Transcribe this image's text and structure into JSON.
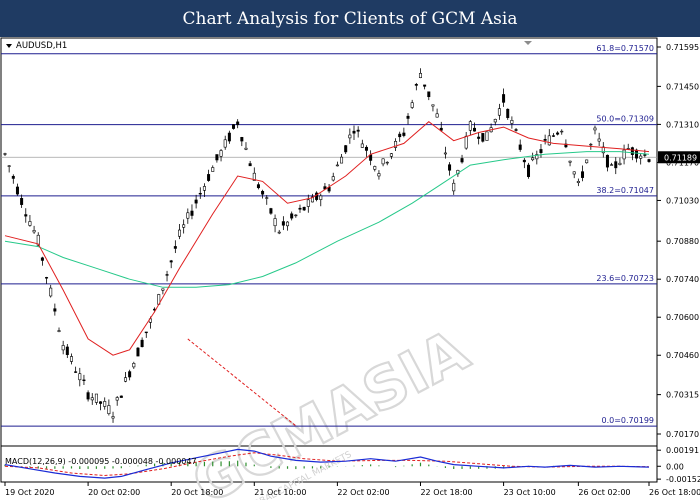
{
  "header": {
    "title": "Chart Analysis for Clients of GCM Asia"
  },
  "chart_data": {
    "type": "candlestick",
    "symbol": "AUDUSD,H1",
    "watermark": "GCMASIA",
    "watermark_sub": "GLOBAL CAPITAL MARKETS",
    "colors": {
      "background": "#ffffff",
      "bull_candle": "#ffffff",
      "bear_candle": "#000000",
      "fib_lines": "#1d1d8f",
      "ma_fast": "#e02020",
      "ma_slow": "#27c98a",
      "macd_line": "#1a2bd6",
      "signal_line": "#e02020",
      "histogram": "#2f8f2f",
      "price_label_bg": "#000000"
    },
    "y_ticks": [
      "0.71595",
      "0.71450",
      "0.71310",
      "0.71170",
      "0.71030",
      "0.70880",
      "0.70740",
      "0.70600",
      "0.70460",
      "0.70315",
      "0.70170"
    ],
    "ylim": [
      0.7017,
      0.71595
    ],
    "x_ticks": [
      "19 Oct 2020",
      "20 Oct 02:00",
      "20 Oct 18:00",
      "21 Oct 10:00",
      "22 Oct 02:00",
      "22 Oct 18:00",
      "23 Oct 10:00",
      "26 Oct 02:00",
      "26 Oct 18:00"
    ],
    "current_price": "0.71189",
    "fib_levels": [
      {
        "label": "61.8=0.71570",
        "value": 0.7157
      },
      {
        "label": "50.0=0.71309",
        "value": 0.71309
      },
      {
        "label": "38.2=0.71047",
        "value": 0.71047
      },
      {
        "label": "23.6=0.70723",
        "value": 0.70723
      },
      {
        "label": "0.0=0.70199",
        "value": 0.70199
      }
    ],
    "price_path": [
      [
        0,
        0.712
      ],
      [
        4,
        0.7103
      ],
      [
        8,
        0.7088
      ],
      [
        14,
        0.705
      ],
      [
        20,
        0.7032
      ],
      [
        26,
        0.7025
      ],
      [
        30,
        0.704
      ],
      [
        36,
        0.7062
      ],
      [
        42,
        0.709
      ],
      [
        50,
        0.7115
      ],
      [
        56,
        0.7132
      ],
      [
        60,
        0.7112
      ],
      [
        66,
        0.7092
      ],
      [
        72,
        0.71
      ],
      [
        78,
        0.7108
      ],
      [
        84,
        0.713
      ],
      [
        90,
        0.7114
      ],
      [
        96,
        0.7128
      ],
      [
        100,
        0.715
      ],
      [
        104,
        0.7134
      ],
      [
        108,
        0.7108
      ],
      [
        112,
        0.713
      ],
      [
        116,
        0.7126
      ],
      [
        120,
        0.714
      ],
      [
        126,
        0.7114
      ],
      [
        130,
        0.7124
      ],
      [
        134,
        0.713
      ],
      [
        138,
        0.7108
      ],
      [
        142,
        0.7128
      ],
      [
        146,
        0.7114
      ],
      [
        150,
        0.7122
      ],
      [
        155,
        0.7119
      ]
    ],
    "ma_fast_path": [
      [
        0,
        0.709
      ],
      [
        8,
        0.7087
      ],
      [
        14,
        0.707
      ],
      [
        20,
        0.7052
      ],
      [
        26,
        0.7046
      ],
      [
        30,
        0.7048
      ],
      [
        36,
        0.7062
      ],
      [
        42,
        0.7078
      ],
      [
        50,
        0.7098
      ],
      [
        56,
        0.7112
      ],
      [
        62,
        0.711
      ],
      [
        68,
        0.7102
      ],
      [
        74,
        0.7104
      ],
      [
        82,
        0.7112
      ],
      [
        88,
        0.712
      ],
      [
        96,
        0.7124
      ],
      [
        102,
        0.7132
      ],
      [
        108,
        0.7125
      ],
      [
        114,
        0.7128
      ],
      [
        120,
        0.713
      ],
      [
        126,
        0.7126
      ],
      [
        132,
        0.7124
      ],
      [
        140,
        0.7123
      ],
      [
        148,
        0.7122
      ],
      [
        155,
        0.7121
      ]
    ],
    "ma_slow_path": [
      [
        0,
        0.7088
      ],
      [
        8,
        0.7086
      ],
      [
        14,
        0.7082
      ],
      [
        22,
        0.7078
      ],
      [
        30,
        0.7074
      ],
      [
        38,
        0.7071
      ],
      [
        46,
        0.7071
      ],
      [
        54,
        0.7072
      ],
      [
        62,
        0.7075
      ],
      [
        70,
        0.708
      ],
      [
        80,
        0.7088
      ],
      [
        90,
        0.7095
      ],
      [
        98,
        0.7102
      ],
      [
        104,
        0.7108
      ],
      [
        112,
        0.7116
      ],
      [
        120,
        0.7118
      ],
      [
        130,
        0.712
      ],
      [
        140,
        0.7121
      ],
      [
        148,
        0.7121
      ],
      [
        155,
        0.712
      ]
    ],
    "macd": {
      "label": "MACD(12,26,9) -0.000095 -0.000048 -0.000047",
      "y_ticks": [
        "0.00191",
        "0.00",
        "-0.001527"
      ],
      "ylim": [
        -0.00175,
        0.00205
      ],
      "macd_path": [
        [
          0,
          0.0002
        ],
        [
          6,
          -0.0003
        ],
        [
          12,
          -0.0008
        ],
        [
          18,
          -0.0012
        ],
        [
          24,
          -0.0014
        ],
        [
          28,
          -0.0012
        ],
        [
          34,
          -0.0004
        ],
        [
          40,
          0.0004
        ],
        [
          46,
          0.001
        ],
        [
          52,
          0.0016
        ],
        [
          56,
          0.002
        ],
        [
          60,
          0.0018
        ],
        [
          64,
          0.0012
        ],
        [
          70,
          0.0007
        ],
        [
          76,
          0.0005
        ],
        [
          82,
          0.0006
        ],
        [
          88,
          0.0009
        ],
        [
          94,
          0.0006
        ],
        [
          100,
          0.0011
        ],
        [
          104,
          0.0006
        ],
        [
          108,
          0.0002
        ],
        [
          114,
          0.0
        ],
        [
          120,
          -0.0002
        ],
        [
          126,
          0.0
        ],
        [
          130,
          -0.0001
        ],
        [
          136,
          0.0001
        ],
        [
          142,
          -0.0001
        ],
        [
          148,
          0.0
        ],
        [
          155,
          -0.0001
        ]
      ],
      "signal_path": [
        [
          0,
          0.0
        ],
        [
          8,
          -0.0002
        ],
        [
          16,
          -0.0008
        ],
        [
          24,
          -0.0011
        ],
        [
          30,
          -0.0009
        ],
        [
          38,
          -0.0003
        ],
        [
          46,
          0.0005
        ],
        [
          54,
          0.0012
        ],
        [
          60,
          0.0016
        ],
        [
          66,
          0.0013
        ],
        [
          72,
          0.0009
        ],
        [
          80,
          0.0006
        ],
        [
          90,
          0.0007
        ],
        [
          98,
          0.0007
        ],
        [
          106,
          0.0006
        ],
        [
          114,
          0.0003
        ],
        [
          122,
          0.0
        ],
        [
          130,
          -0.0001
        ],
        [
          140,
          0.0
        ],
        [
          148,
          0.0
        ],
        [
          155,
          -5e-05
        ]
      ]
    }
  }
}
